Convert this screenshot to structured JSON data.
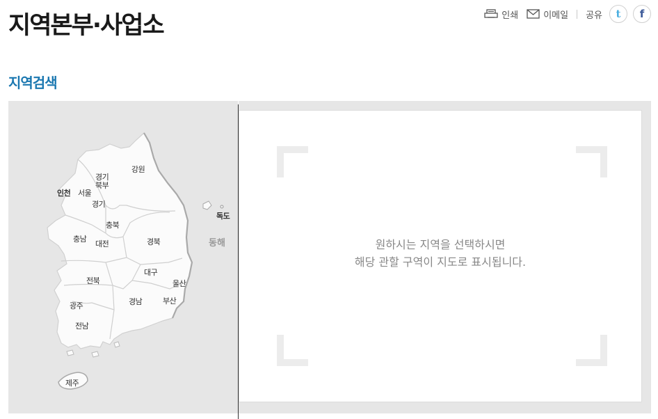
{
  "page": {
    "title": "지역본부·사업소"
  },
  "utility": {
    "print_label": "인쇄",
    "email_label": "이메일",
    "share_label": "공유",
    "twitter_glyph": "t",
    "facebook_glyph": "f"
  },
  "section": {
    "title": "지역검색"
  },
  "map": {
    "regions": {
      "gangwon": "강원",
      "gyeonggi_north": "경기\n북부",
      "incheon": "인천",
      "seoul": "서울",
      "gyeonggi": "경기",
      "chungbuk": "충북",
      "chungnam": "충남",
      "daejeon": "대전",
      "gyeongbuk": "경북",
      "daegu": "대구",
      "ulsan": "울산",
      "jeonbuk": "전북",
      "gyeongnam": "경남",
      "busan": "부산",
      "gwangju": "광주",
      "jeonnam": "전남",
      "jeju": "제주",
      "dokdo": "독도"
    },
    "sea_label": "동해"
  },
  "result": {
    "message_line1": "원하시는 지역을 선택하시면",
    "message_line2": "해당 관할 구역이 지도로 표시됩니다."
  },
  "colors": {
    "section_title": "#1a77b0",
    "panel_bg": "#e6e6e6",
    "twitter": "#4aaee0",
    "facebook": "#3b5998"
  },
  "icons": {
    "print": "printer-icon",
    "email": "envelope-icon",
    "twitter": "twitter-icon",
    "facebook": "facebook-icon"
  }
}
